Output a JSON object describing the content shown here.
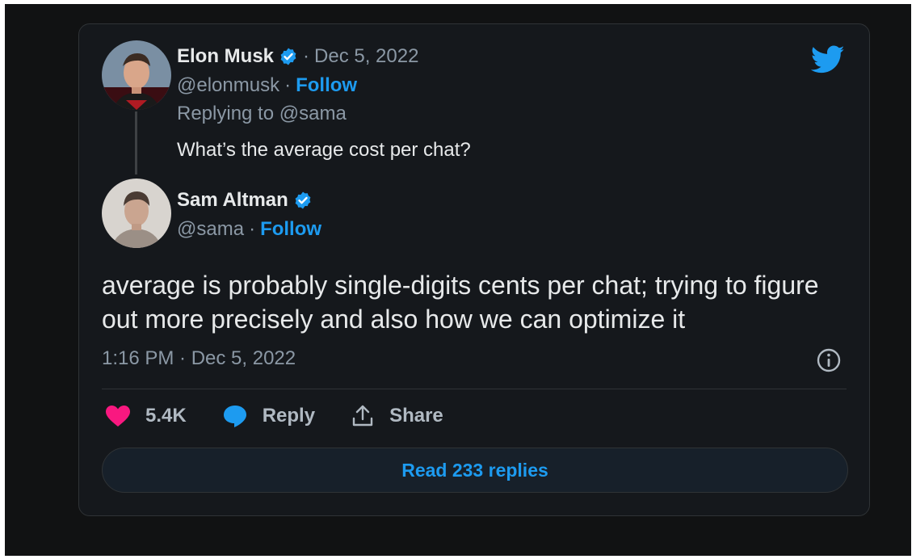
{
  "quoted_tweet": {
    "author_name": "Elon Musk",
    "date": "Dec 5, 2022",
    "handle": "@elonmusk",
    "follow_label": "Follow",
    "replying_to": "Replying to @sama",
    "text": "What’s the average cost per chat?"
  },
  "main_tweet": {
    "author_name": "Sam Altman",
    "handle": "@sama",
    "follow_label": "Follow",
    "text": "average is probably single-digits cents per chat; trying to figure out more precisely and also how we can optimize it",
    "timestamp": "1:16 PM · Dec 5, 2022"
  },
  "actions": {
    "like_count": "5.4K",
    "reply_label": "Reply",
    "share_label": "Share"
  },
  "read_replies_label": "Read 233 replies",
  "separator": "·",
  "icons": {
    "brand": "twitter-bird-icon",
    "verified": "verified-badge-icon",
    "info": "info-icon",
    "like": "heart-icon",
    "reply": "speech-bubble-icon",
    "share": "share-upload-icon"
  },
  "colors": {
    "background": "#15181c",
    "accent": "#1d9bf0",
    "like": "#f91880",
    "muted_text": "#8b98a5"
  }
}
